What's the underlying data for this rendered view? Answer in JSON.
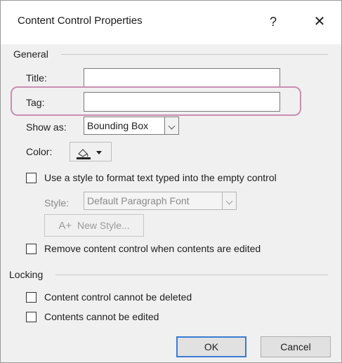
{
  "dialog": {
    "title": "Content Control Properties",
    "help_glyph": "?",
    "close_glyph": "✕"
  },
  "general": {
    "section_label": "General",
    "title_label": "Title:",
    "title_value": "",
    "tag_label": "Tag:",
    "tag_value": "",
    "show_as_label": "Show as:",
    "show_as_value": "Bounding Box",
    "color_label": "Color:",
    "use_style_checkbox": {
      "label": "Use a style to format text typed into the empty control",
      "checked": false
    },
    "style_label": "Style:",
    "style_value": "Default Paragraph Font",
    "new_style_button": "New Style...",
    "new_style_icon_text": "A+",
    "remove_checkbox": {
      "label": "Remove content control when contents are edited",
      "checked": false
    }
  },
  "locking": {
    "section_label": "Locking",
    "cannot_delete": {
      "label": "Content control cannot be deleted",
      "checked": false
    },
    "cannot_edit": {
      "label": "Contents cannot be edited",
      "checked": false
    }
  },
  "footer": {
    "ok_label": "OK",
    "cancel_label": "Cancel"
  },
  "colors": {
    "highlight": "#c98eb2",
    "primary_button_border": "#3a7bd5"
  }
}
